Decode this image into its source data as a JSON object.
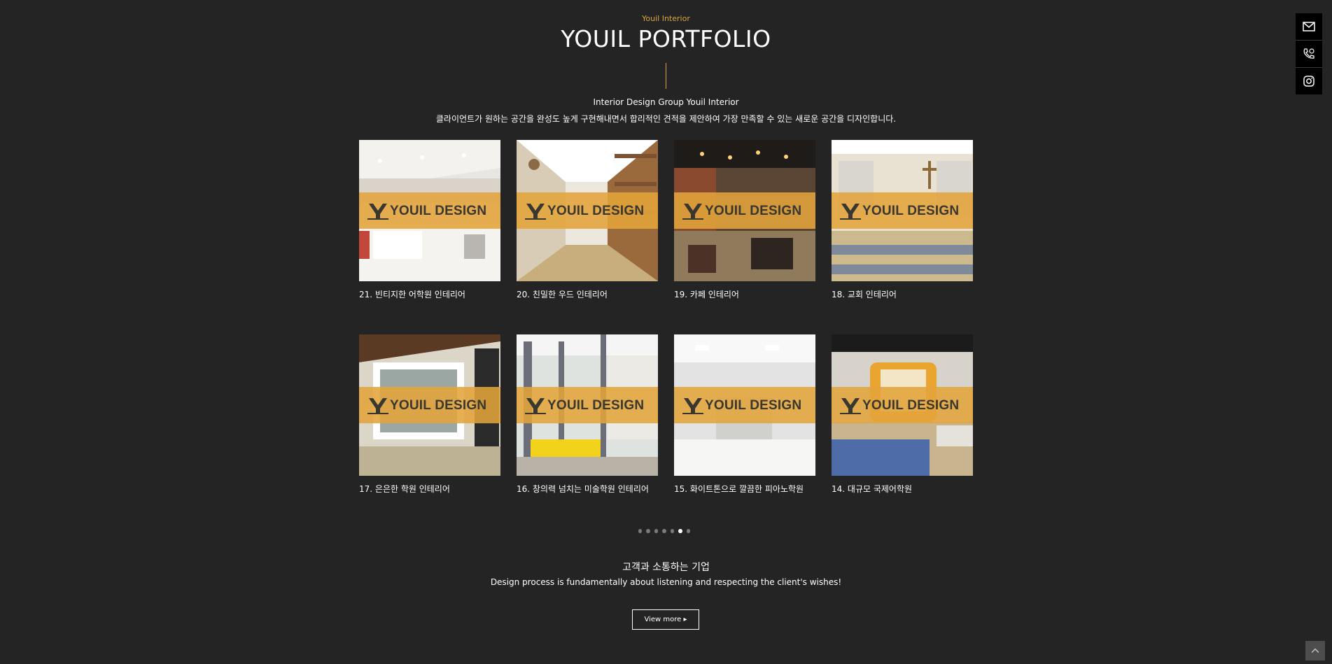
{
  "header": {
    "eyebrow": "Youil Interior",
    "title": "YOUIL PORTFOLIO",
    "subtitle_en": "Interior Design Group Youil Interior",
    "subtitle_ko": "클라이언트가 원하는 공간을 완성도 높게 구현해내면서 합리적인 견적을 제안하여 가장 만족할 수 있는 새로운 공간을 디자인합니다."
  },
  "watermark": "YOUIL DESIGN",
  "portfolio": [
    {
      "caption": "21. 빈티지한 어학원 인테리어"
    },
    {
      "caption": "20. 친밀한 우드 인테리어"
    },
    {
      "caption": "19. 카페 인테리어"
    },
    {
      "caption": "18. 교회 인테리어"
    },
    {
      "caption": "17. 은은한 학원 인테리어"
    },
    {
      "caption": "16. 창의력 넘치는 미술학원 인테리어"
    },
    {
      "caption": "15. 화이트톤으로 깔끔한 피아노학원"
    },
    {
      "caption": "14. 대규모 국제어학원"
    }
  ],
  "pagination": {
    "count": 7,
    "active_index": 5
  },
  "footer": {
    "title": "고객과 소통하는 기업",
    "subtitle": "Design process is fundamentally about listening and respecting the client's wishes!",
    "button": "View more ▸"
  },
  "side_icons": [
    "mail-icon",
    "phone-icon",
    "instagram-icon"
  ],
  "colors": {
    "background": "#252424",
    "accent": "#d8a640",
    "watermark_band": "#e3a43a"
  }
}
